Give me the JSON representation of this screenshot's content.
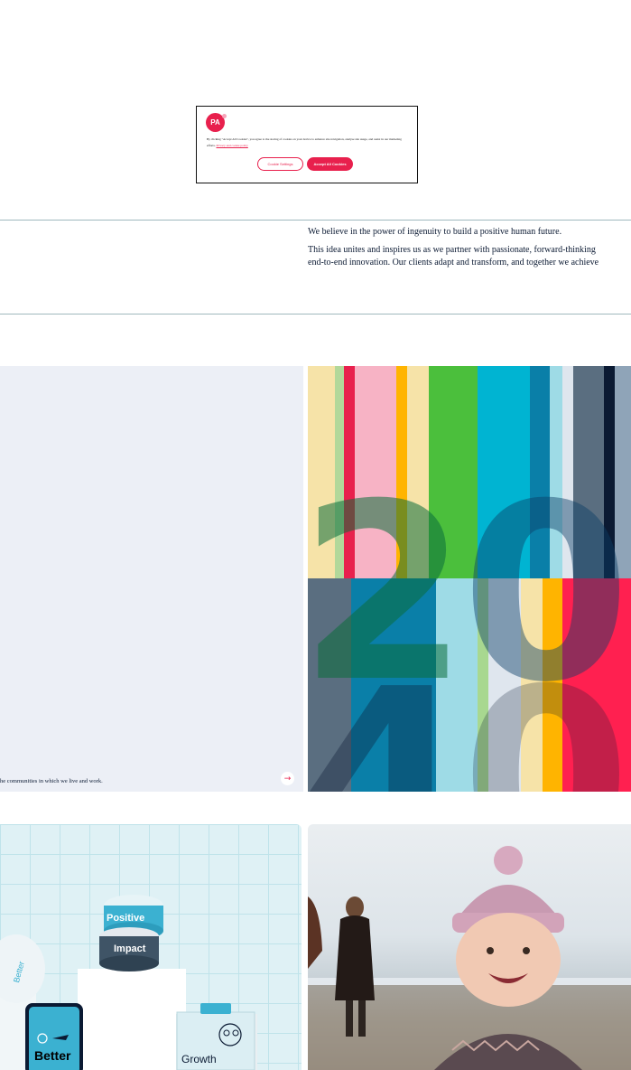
{
  "cookie_banner": {
    "logo_text": "PA",
    "body_text": "By clicking \"Accept All Cookies\", you agree to the storing of cookies on your device to enhance site navigation, analyse site usage, and assist in our marketing efforts.",
    "policy_link": "Privacy and cookie policy",
    "settings_button": "Cookie Settings",
    "accept_button": "Accept All Cookies",
    "accent_color": "#e8204d"
  },
  "intro": {
    "line1": "We believe in the power of ingenuity to build a positive human future.",
    "line2": "This idea unites and inspires us as we partner with passionate, forward-thinking",
    "line3": "end-to-end innovation. Our clients adapt and transform, and together we achieve"
  },
  "feature_card": {
    "caption": "he communities in which we live and work.",
    "arrow_icon": "arrow-right-icon"
  },
  "stripe_graphic": {
    "digits": [
      "2",
      "0",
      "4",
      "0"
    ]
  },
  "product_card": {
    "labels": [
      "Positive",
      "Impact",
      "Better",
      "Better",
      "Growth"
    ]
  },
  "photo_card": {
    "description_icon": "photo"
  }
}
